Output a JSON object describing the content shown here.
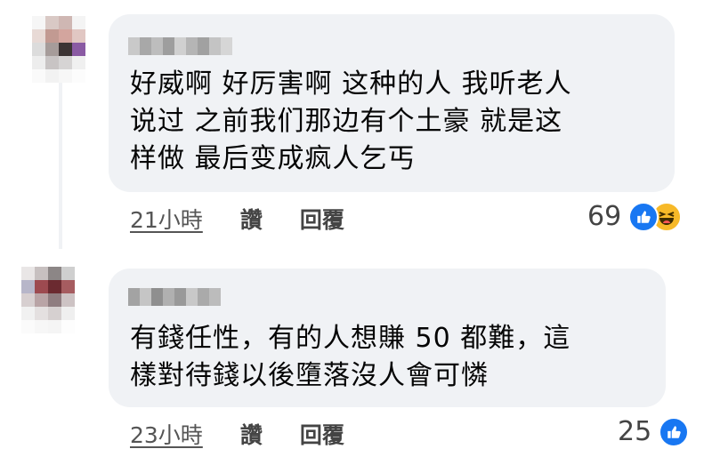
{
  "comments": [
    {
      "text_lines": [
        "好威啊 好厉害啊 这种的人 我听老人",
        "说过 之前我们那边有个土豪 就是这",
        "样做 最后变成疯人乞丐"
      ],
      "time": "21小時",
      "like_label": "讚",
      "reply_label": "回覆",
      "reaction_count": "69",
      "reactions": [
        "like-icon",
        "haha-icon"
      ]
    },
    {
      "text_lines": [
        "有錢任性，有的人想賺 50 都難，這",
        "樣對待錢以後墮落沒人會可憐"
      ],
      "time": "23小時",
      "like_label": "讚",
      "reply_label": "回覆",
      "reaction_count": "25",
      "reactions": [
        "like-icon"
      ]
    }
  ],
  "colors": {
    "bubble": "#f0f2f5",
    "like_blue": "#1877f2",
    "haha_yellow": "#f7b928"
  }
}
